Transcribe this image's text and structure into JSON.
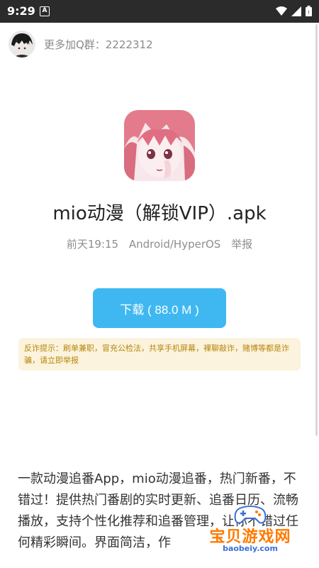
{
  "status_bar": {
    "time": "9:29",
    "notification_letter": "A"
  },
  "group": {
    "text": "更多加Q群：2222312"
  },
  "app": {
    "title": "mio动漫（解锁VIP）.apk",
    "date": "前天19:15",
    "platform": "Android/HyperOS",
    "report": "举报"
  },
  "download": {
    "label": "下载 ( 88.0 M )"
  },
  "warning": {
    "text": "反诈提示：刷单兼职，冒充公检法，共享手机屏幕，裸聊敲诈，赌博等都是诈骗，请立即举报"
  },
  "description": {
    "text": "一款动漫追番App，mio动漫追番，热门新番，不错过！提供热门番剧的实时更新、追番日历、流畅播放，支持个性化推荐和追番管理，让你不错过任何精彩瞬间。界面简洁，作"
  },
  "watermark": {
    "text": "宝贝游戏网",
    "url": "baobeiy.com"
  },
  "colors": {
    "accent": "#3fb8f2",
    "warning_bg": "#fbf3dd",
    "warning_text": "#b8860b"
  }
}
